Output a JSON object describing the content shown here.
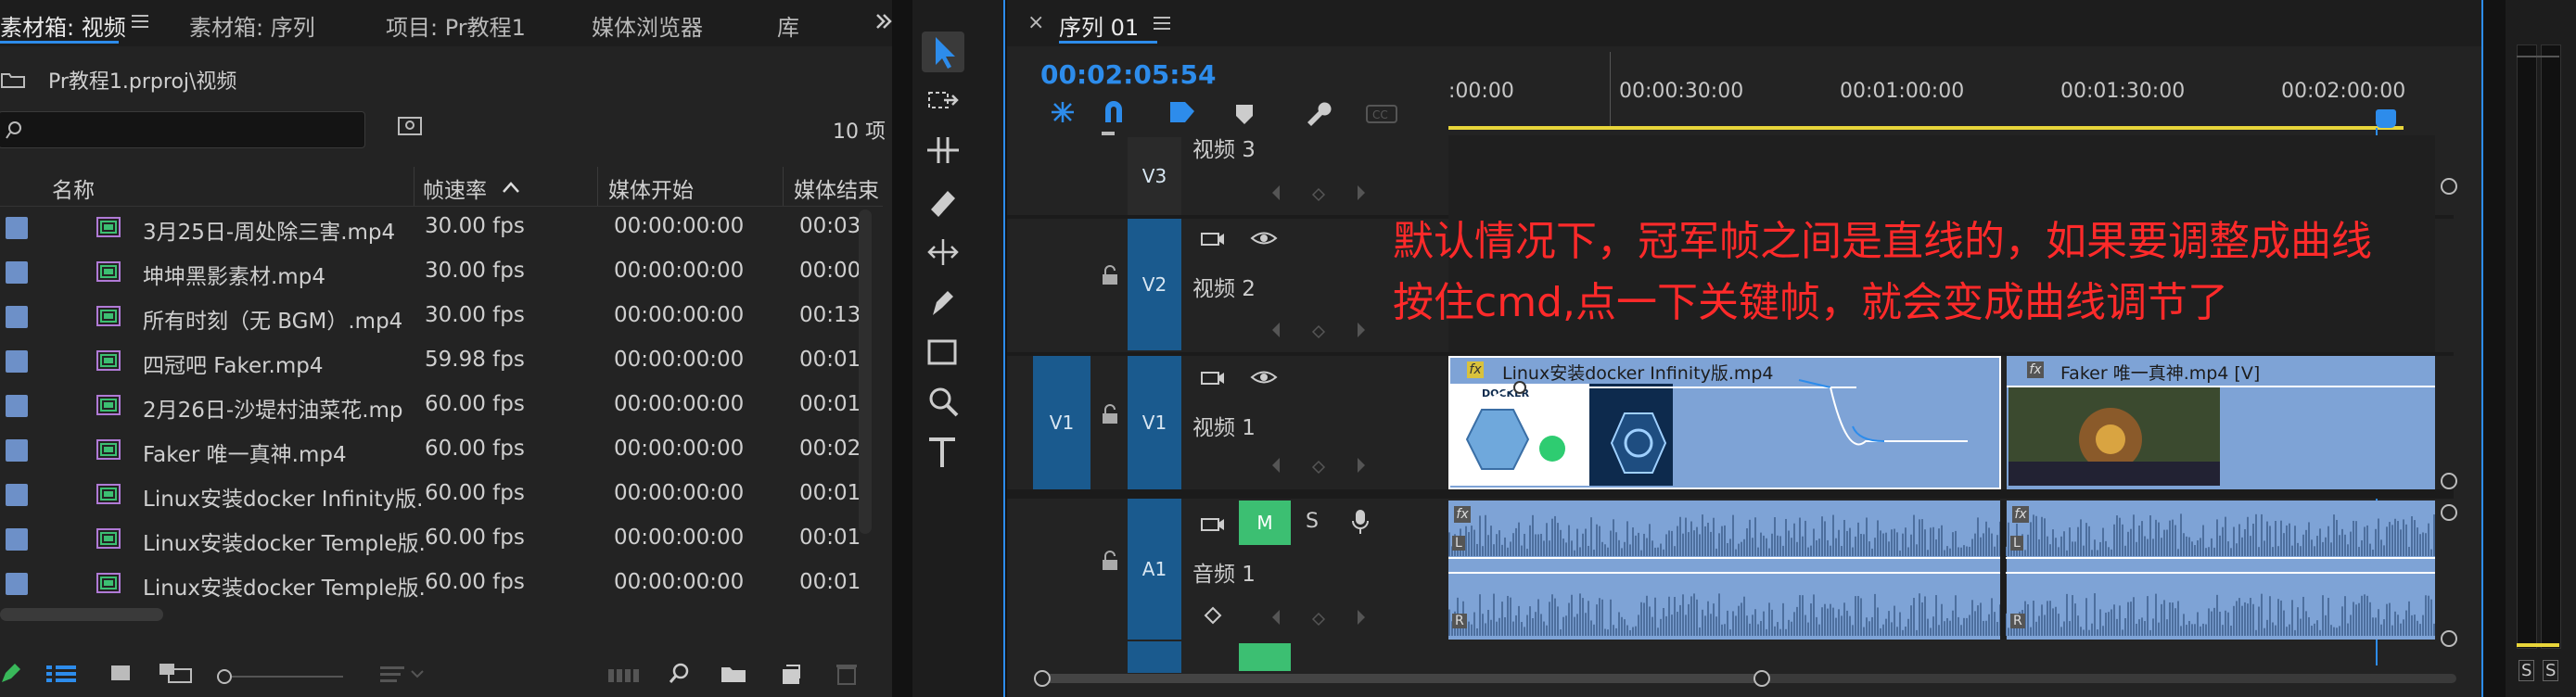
{
  "left_panel": {
    "tabs": [
      {
        "label": "素材箱: 视频"
      },
      {
        "label": "素材箱: 序列"
      },
      {
        "label": "项目: Pr教程1"
      },
      {
        "label": "媒体浏览器"
      },
      {
        "label": "库"
      }
    ],
    "path": "Pr教程1.prproj\\视频",
    "search_placeholder": "",
    "item_count": "10 项",
    "columns": [
      "名称",
      "帧速率",
      "媒体开始",
      "媒体结束"
    ],
    "rows": [
      {
        "name": "3月25日-周处除三害.mp4",
        "fps": "30.00 fps",
        "start": "00:00:00:00",
        "end": "00:03:"
      },
      {
        "name": "坤坤黑影素材.mp4",
        "fps": "30.00 fps",
        "start": "00:00:00:00",
        "end": "00:00:"
      },
      {
        "name": "所有时刻（无 BGM）.mp4",
        "fps": "30.00 fps",
        "start": "00:00:00:00",
        "end": "00:13:"
      },
      {
        "name": "四冠吧 Faker.mp4",
        "fps": "59.98 fps",
        "start": "00:00:00:00",
        "end": "00:01:"
      },
      {
        "name": "2月26日-沙堤村油菜花.mp",
        "fps": "60.00 fps",
        "start": "00:00:00:00",
        "end": "00:01:"
      },
      {
        "name": "Faker 唯一真神.mp4",
        "fps": "60.00 fps",
        "start": "00:00:00:00",
        "end": "00:02:"
      },
      {
        "name": "Linux安装docker Infinity版.",
        "fps": "60.00 fps",
        "start": "00:00:00:00",
        "end": "00:01:"
      },
      {
        "name": "Linux安装docker Temple版.",
        "fps": "60.00 fps",
        "start": "00:00:00:00",
        "end": "00:01:"
      },
      {
        "name": "Linux安装docker Temple版.",
        "fps": "60.00 fps",
        "start": "00:00:00:00",
        "end": "00:01:"
      }
    ]
  },
  "timeline": {
    "close_symbol": "×",
    "sequence_tab": "序列 01",
    "timecode": "00:02:05:54",
    "ruler": [
      ":00:00",
      "00:00:30:00",
      "00:01:00:00",
      "00:01:30:00",
      "00:02:00:00"
    ],
    "tracks": {
      "v3": {
        "tag": "V3",
        "name": "视频 3"
      },
      "v2": {
        "tag": "V2",
        "name": "视频 2"
      },
      "v1": {
        "source": "V1",
        "tag": "V1",
        "name": "视频 1"
      },
      "a1": {
        "tag": "A1",
        "name": "音频 1",
        "mute": "M",
        "solo": "S"
      }
    },
    "clips": {
      "clip1": "Linux安装docker Infinity版.mp4",
      "clip1_thumb_text": "DOCKER",
      "clip2": "Faker 唯一真神.mp4 [V]",
      "fx": "fx",
      "audio_l": "L",
      "audio_r": "R"
    },
    "annotation": {
      "line1": "默认情况下，冠军帧之间是直线的，如果要调整成曲线",
      "line2": "按住cmd,点一下关键帧，就会变成曲线调节了"
    }
  },
  "meter": {
    "labels": [
      "S",
      "S"
    ]
  },
  "colors": {
    "accent_blue": "#2d8ceb",
    "clip_blue": "#7ea3d6",
    "track_tag": "#1a5a8e",
    "mute_green": "#3cbf72",
    "annotation_red": "#ff2a2a",
    "ruler_yellow": "#e8d53a"
  }
}
